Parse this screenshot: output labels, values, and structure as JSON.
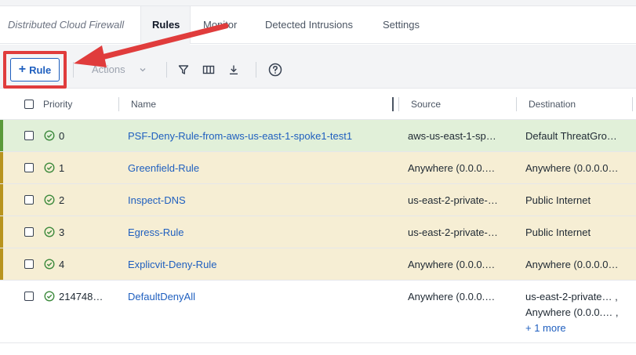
{
  "header": {
    "app_title": "Distributed Cloud Firewall",
    "tabs": [
      {
        "label": "Rules",
        "active": true
      },
      {
        "label": "Monitor",
        "active": false
      },
      {
        "label": "Detected Intrusions",
        "active": false
      },
      {
        "label": "Settings",
        "active": false
      }
    ]
  },
  "toolbar": {
    "add_rule_label": "Rule",
    "actions_label": "Actions",
    "icons": [
      "filter-icon",
      "columns-icon",
      "download-icon",
      "help-icon"
    ]
  },
  "table": {
    "columns": [
      "Priority",
      "Name",
      "Source",
      "Destination"
    ],
    "rows": [
      {
        "priority": "0",
        "name": "PSF-Deny-Rule-from-aws-us-east-1-spoke1-test1",
        "source": "aws-us-east-1-sp…",
        "destination": "Default ThreatGro…",
        "tone": "green"
      },
      {
        "priority": "1",
        "name": "Greenfield-Rule",
        "source": "Anywhere (0.0.0.0…",
        "destination": "Anywhere (0.0.0.0…",
        "tone": "yellow"
      },
      {
        "priority": "2",
        "name": "Inspect-DNS",
        "source": "us-east-2-private-…",
        "destination": "Public Internet",
        "tone": "yellow"
      },
      {
        "priority": "3",
        "name": "Egress-Rule",
        "source": "us-east-2-private-…",
        "destination": "Public Internet",
        "tone": "yellow"
      },
      {
        "priority": "4",
        "name": "Explicvit-Deny-Rule",
        "source": "Anywhere (0.0.0.0…",
        "destination": "Anywhere (0.0.0.0…",
        "tone": "yellow"
      },
      {
        "priority": "214748…",
        "name": "DefaultDenyAll",
        "source": "Anywhere (0.0.0.0…",
        "destination": "us-east-2-private… ,",
        "destination_2": "Anywhere (0.0.0.… ,",
        "more": "+ 1 more",
        "tone": "plain"
      }
    ]
  },
  "colors": {
    "accent": "#1f5fbf",
    "highlight": "#e03c3c",
    "row_green": "#e1f0d9",
    "row_yellow": "#f6eed4",
    "stripe_green": "#5a9a3a",
    "stripe_yellow": "#b8941f",
    "status_ok": "#3d8a3d"
  }
}
